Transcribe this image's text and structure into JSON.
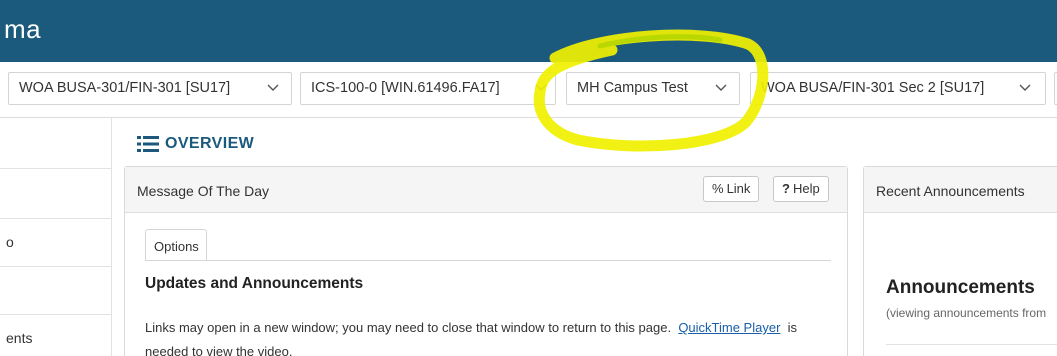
{
  "header": {
    "brand": "ma",
    "background": "#1b5a7c"
  },
  "site_tabs": [
    {
      "label": "WOA BUSA-301/FIN-301 [SU17]",
      "icon": "chevron-down-icon"
    },
    {
      "label": "ICS-100-0 [WIN.61496.FA17]",
      "icon": "chevron-down-icon"
    },
    {
      "label": "MH Campus Test",
      "icon": "chevron-down-icon"
    },
    {
      "label": "WOA BUSA/FIN-301 Sec 2 [SU17]",
      "icon": "chevron-down-icon"
    }
  ],
  "left_nav": {
    "items": [
      {
        "label": ""
      },
      {
        "label": "o"
      },
      {
        "label": ""
      },
      {
        "label": "ents"
      }
    ]
  },
  "overview": {
    "title": "OVERVIEW",
    "icon": "list-icon"
  },
  "motd": {
    "title": "Message Of The Day",
    "link_button": "Link",
    "help_button": "Help",
    "options_tab": "Options",
    "heading": "Updates and Announcements",
    "body_prefix": "Links may open in a new window; you may need to close that window to return to this page.",
    "body_link": "QuickTime Player",
    "body_suffix": "is needed to view the video."
  },
  "announcements": {
    "title": "Recent Announcements",
    "heading": "Announcements",
    "subtext": "(viewing announcements from"
  },
  "annotation": {
    "highlight_color": "#f0f000"
  }
}
